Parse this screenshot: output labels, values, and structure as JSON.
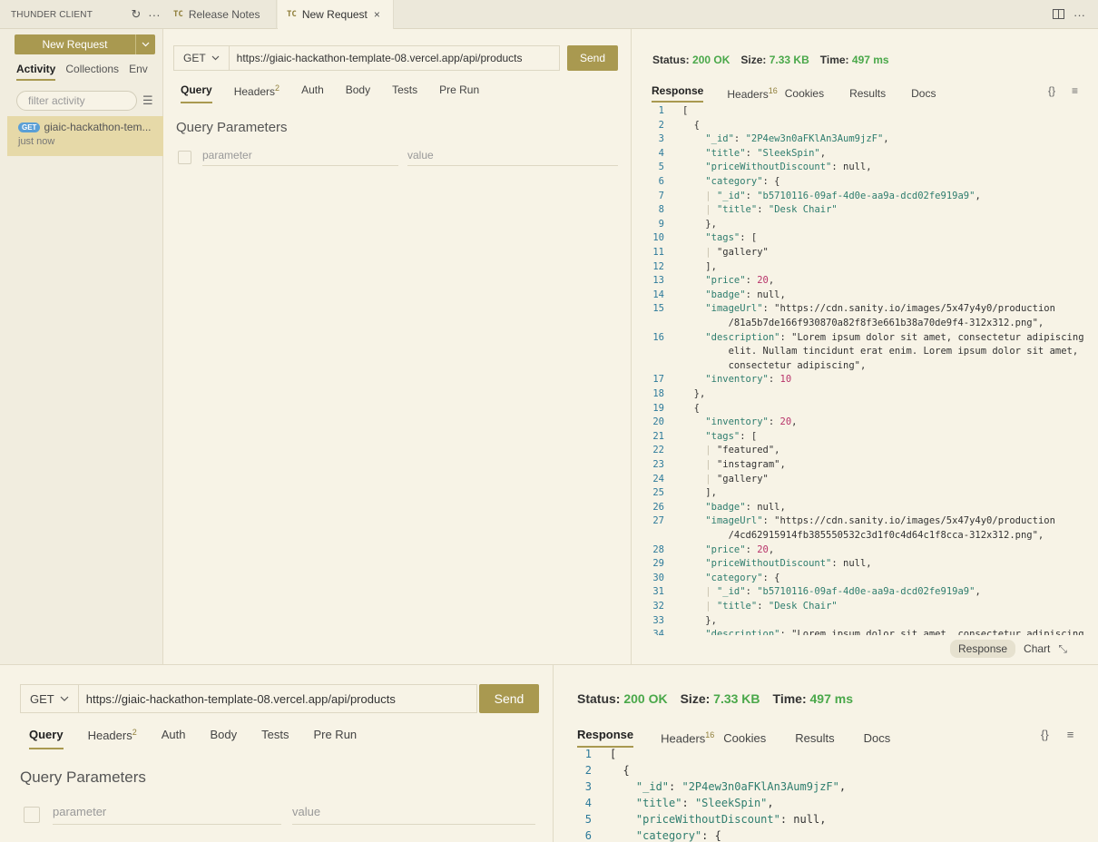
{
  "sidebar": {
    "title": "THUNDER CLIENT",
    "new_request": "New Request",
    "tabs": [
      "Activity",
      "Collections",
      "Env"
    ],
    "filter_placeholder": "filter activity",
    "activity": {
      "method": "GET",
      "name": "giaic-hackathon-tem...",
      "time": "just now"
    }
  },
  "tabs": [
    {
      "badge": "TC",
      "label": "Release Notes"
    },
    {
      "badge": "TC",
      "label": "New Request",
      "close": "×"
    }
  ],
  "request": {
    "method": "GET",
    "url": "https://giaic-hackathon-template-08.vercel.app/api/products",
    "send": "Send",
    "tabs": {
      "query": "Query",
      "headers": "Headers",
      "headers_count": "2",
      "auth": "Auth",
      "body": "Body",
      "tests": "Tests",
      "prerun": "Pre Run"
    },
    "query_title": "Query Parameters",
    "param_placeholder": "parameter",
    "value_placeholder": "value"
  },
  "response": {
    "status_label": "Status:",
    "status_value": "200 OK",
    "size_label": "Size:",
    "size_value": "7.33 KB",
    "time_label": "Time:",
    "time_value": "497 ms",
    "tabs": {
      "response": "Response",
      "headers": "Headers",
      "headers_count": "16",
      "cookies": "Cookies",
      "results": "Results",
      "docs": "Docs"
    },
    "tools": {
      "braces": "{}",
      "menu": "≡"
    },
    "view_response": "Response",
    "view_chart": "Chart"
  },
  "code_lines": [
    [
      "1",
      "["
    ],
    [
      "2",
      "  {"
    ],
    [
      "3",
      "    \"_id\": \"2P4ew3n0aFKlAn3Aum9jzF\","
    ],
    [
      "4",
      "    \"title\": \"SleekSpin\","
    ],
    [
      "5",
      "    \"priceWithoutDiscount\": null,"
    ],
    [
      "6",
      "    \"category\": {"
    ],
    [
      "7",
      "    | \"_id\": \"b5710116-09af-4d0e-aa9a-dcd02fe919a9\","
    ],
    [
      "8",
      "    | \"title\": \"Desk Chair\""
    ],
    [
      "9",
      "    },"
    ],
    [
      "10",
      "    \"tags\": ["
    ],
    [
      "11",
      "    | \"gallery\""
    ],
    [
      "12",
      "    ],"
    ],
    [
      "13",
      "    \"price\": 20,"
    ],
    [
      "14",
      "    \"badge\": null,"
    ],
    [
      "15",
      "    \"imageUrl\": \"https://cdn.sanity.io/images/5x47y4y0/production"
    ],
    [
      "",
      "        /81a5b7de166f930870a82f8f3e661b38a70de9f4-312x312.png\","
    ],
    [
      "16",
      "    \"description\": \"Lorem ipsum dolor sit amet, consectetur adipiscing"
    ],
    [
      "",
      "        elit. Nullam tincidunt erat enim. Lorem ipsum dolor sit amet,"
    ],
    [
      "",
      "        consectetur adipiscing\","
    ],
    [
      "17",
      "    \"inventory\": 10"
    ],
    [
      "18",
      "  },"
    ],
    [
      "19",
      "  {"
    ],
    [
      "20",
      "    \"inventory\": 20,"
    ],
    [
      "21",
      "    \"tags\": ["
    ],
    [
      "22",
      "    | \"featured\","
    ],
    [
      "23",
      "    | \"instagram\","
    ],
    [
      "24",
      "    | \"gallery\""
    ],
    [
      "25",
      "    ],"
    ],
    [
      "26",
      "    \"badge\": null,"
    ],
    [
      "27",
      "    \"imageUrl\": \"https://cdn.sanity.io/images/5x47y4y0/production"
    ],
    [
      "",
      "        /4cd62915914fb385550532c3d1f0c4d64c1f8cca-312x312.png\","
    ],
    [
      "28",
      "    \"price\": 20,"
    ],
    [
      "29",
      "    \"priceWithoutDiscount\": null,"
    ],
    [
      "30",
      "    \"category\": {"
    ],
    [
      "31",
      "    | \"_id\": \"b5710116-09af-4d0e-aa9a-dcd02fe919a9\","
    ],
    [
      "32",
      "    | \"title\": \"Desk Chair\""
    ],
    [
      "33",
      "    },"
    ],
    [
      "34",
      "    \"description\": \"Lorem ipsum dolor sit amet, consectetur adipiscing"
    ]
  ],
  "code_lines_bottom": [
    [
      "1",
      "["
    ],
    [
      "2",
      "  {"
    ],
    [
      "3",
      "    \"_id\": \"2P4ew3n0aFKlAn3Aum9jzF\","
    ],
    [
      "4",
      "    \"title\": \"SleekSpin\","
    ],
    [
      "5",
      "    \"priceWithoutDiscount\": null,"
    ],
    [
      "6",
      "    \"category\": {"
    ]
  ]
}
